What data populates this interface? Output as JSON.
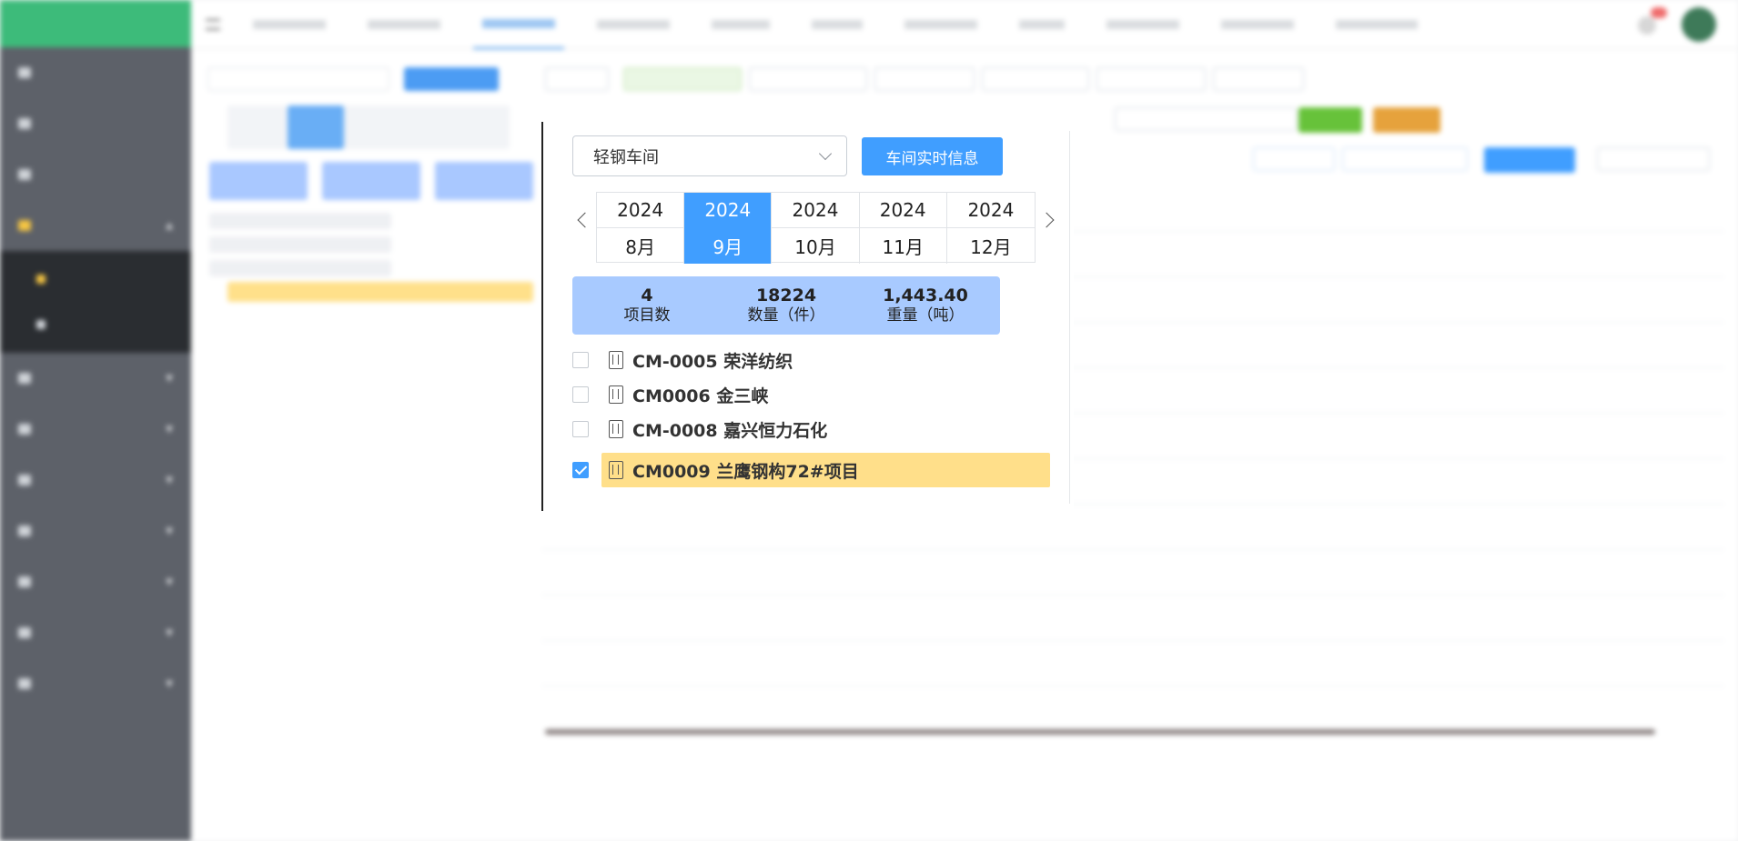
{
  "popup": {
    "workshop_select": "轻钢车间",
    "realtime_button": "车间实时信息",
    "months": [
      {
        "year": "2024",
        "month": "8月",
        "selected": false
      },
      {
        "year": "2024",
        "month": "9月",
        "selected": true
      },
      {
        "year": "2024",
        "month": "10月",
        "selected": false
      },
      {
        "year": "2024",
        "month": "11月",
        "selected": false
      },
      {
        "year": "2024",
        "month": "12月",
        "selected": false
      }
    ],
    "stats": [
      {
        "value": "4",
        "label": "项目数"
      },
      {
        "value": "18224",
        "label": "数量（件）"
      },
      {
        "value": "1,443.40",
        "label": "重量（吨）"
      }
    ],
    "projects": [
      {
        "name": "CM-0005 荣洋纺织",
        "checked": false
      },
      {
        "name": "CM0006 金三峡",
        "checked": false
      },
      {
        "name": "CM-0008 嘉兴恒力石化",
        "checked": false
      },
      {
        "name": "CM0009 兰鹰钢构72#项目",
        "checked": true
      }
    ]
  },
  "colors": {
    "primary": "#409eff",
    "brand_green": "#3dbb7a",
    "sidebar_bg": "#5d6169",
    "stat_card": "#a8caff",
    "selected_project": "#ffdf8a"
  }
}
